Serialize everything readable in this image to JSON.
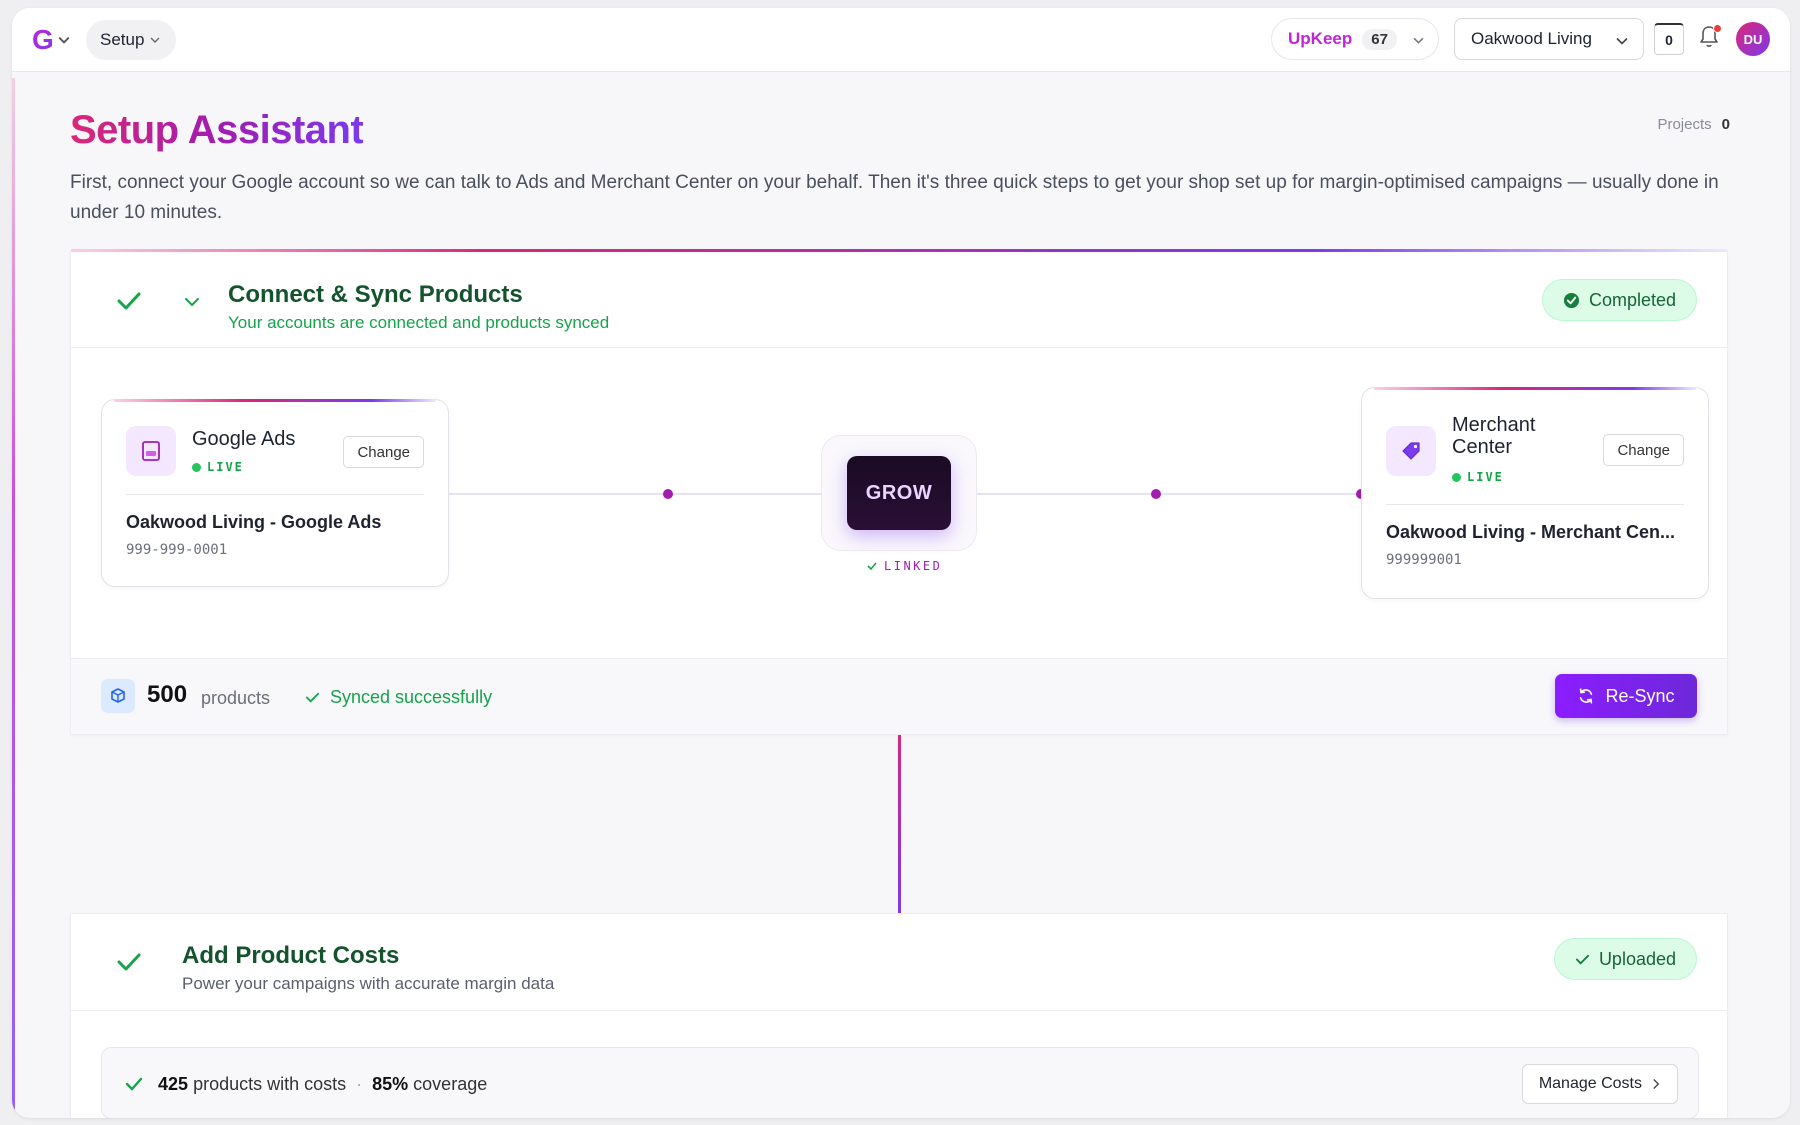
{
  "topbar": {
    "logo_letter": "G",
    "section_label": "Setup",
    "upkeep_label": "UpKeep",
    "upkeep_count": "67",
    "store_name": "Oakwood Living",
    "counter_value": "0",
    "avatar_initials": "DU"
  },
  "page": {
    "title": "Setup Assistant",
    "projects_label": "Projects",
    "projects_count": "0",
    "intro": "First, connect your Google account so we can talk to Ads and Merchant Center on your behalf. Then it's three quick steps to get your shop set up for margin-optimised campaigns — usually done in under 10 minutes."
  },
  "step1": {
    "title": "Connect & Sync Products",
    "subtitle": "Your accounts are connected and products synced",
    "status": "Completed",
    "google_ads": {
      "name": "Google Ads",
      "status": "LIVE",
      "change_label": "Change",
      "account_name": "Oakwood Living - Google Ads",
      "account_id": "999-999-0001",
      "icon": "ads-icon"
    },
    "hub": {
      "label": "GROW",
      "status": "LINKED"
    },
    "merchant": {
      "name": "Merchant Center",
      "status": "LIVE",
      "change_label": "Change",
      "account_name": "Oakwood Living - Merchant Cen...",
      "account_id": "999999001",
      "icon": "tag-icon"
    },
    "footer": {
      "product_count": "500",
      "product_label": "products",
      "sync_status": "Synced successfully",
      "resync_label": "Re-Sync"
    }
  },
  "step2": {
    "title": "Add Product Costs",
    "subtitle": "Power your campaigns with accurate margin data",
    "status": "Uploaded",
    "costs_count": "425",
    "costs_label": "products with costs",
    "coverage_value": "85%",
    "coverage_label": "coverage",
    "manage_label": "Manage Costs"
  },
  "colors": {
    "brand_pink": "#db2777",
    "brand_purple": "#7c3aed",
    "success_green": "#16a34a",
    "success_bg": "#dcfce7"
  }
}
